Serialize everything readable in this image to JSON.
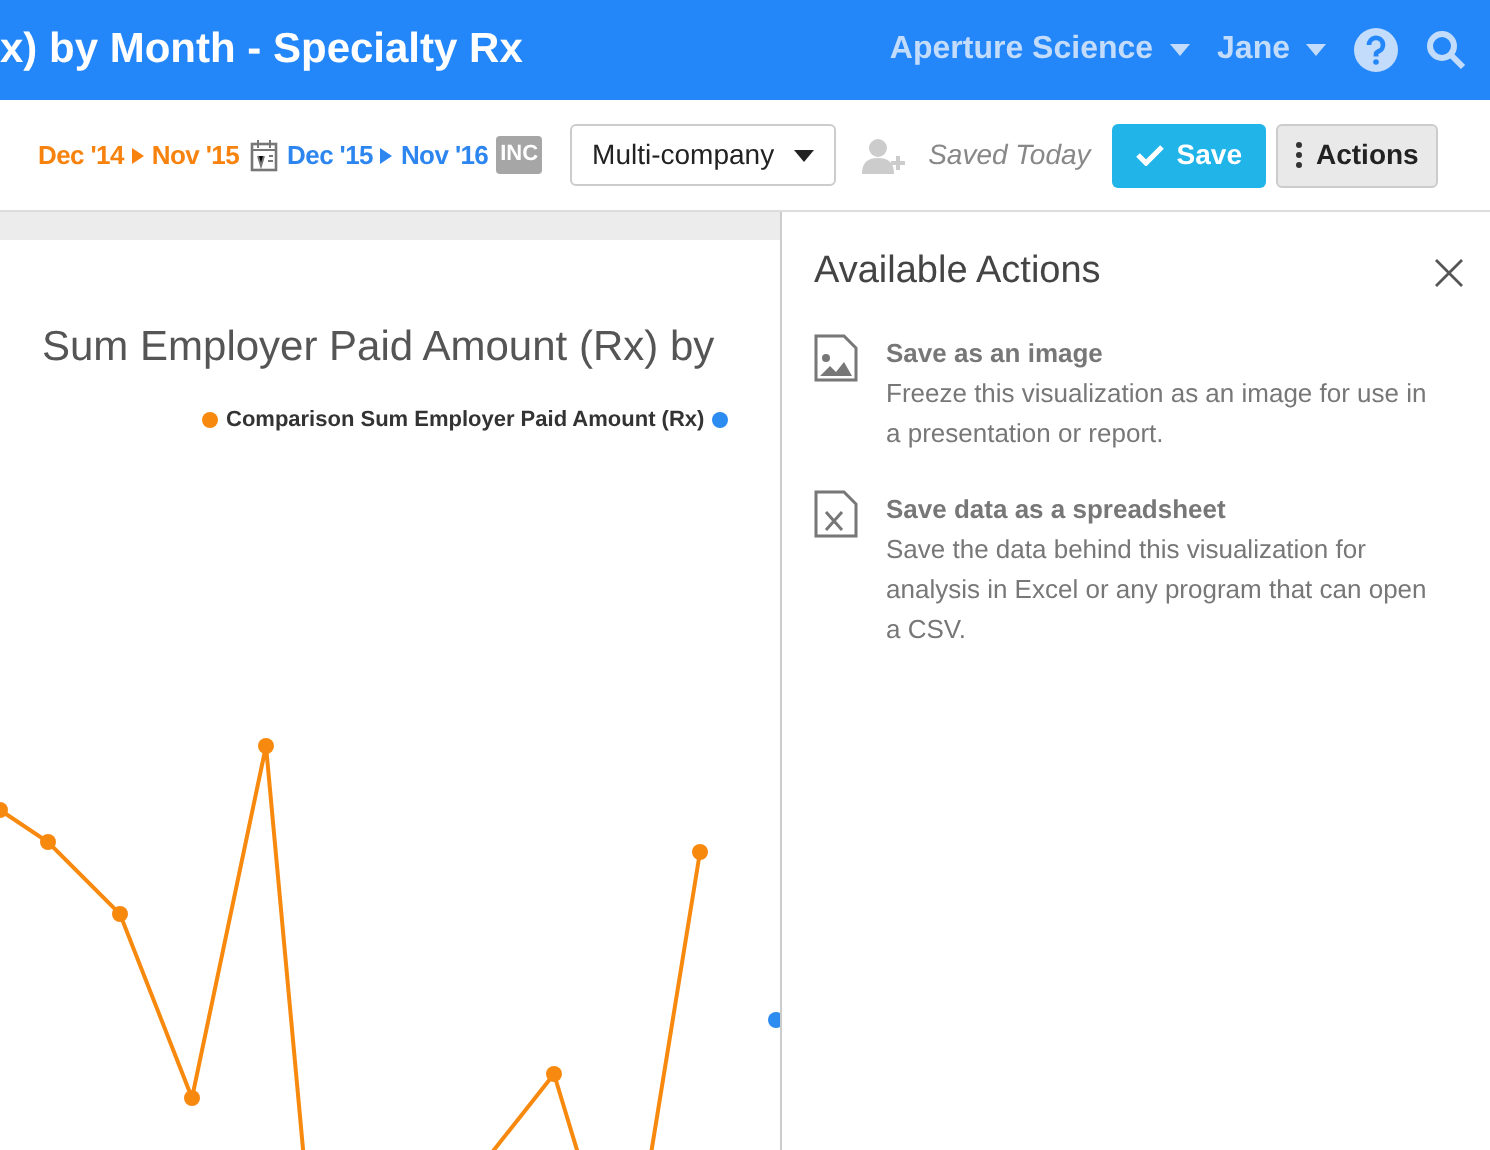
{
  "header": {
    "title": "x) by Month - Specialty Rx",
    "org": "Aperture Science",
    "user": "Jane"
  },
  "toolbar": {
    "range_a": {
      "start": "Dec '14",
      "end": "Nov '15"
    },
    "range_b": {
      "start": "Dec '15",
      "end": "Nov '16"
    },
    "badge": "INC",
    "dropdown": "Multi-company",
    "saved": "Saved Today",
    "save": "Save",
    "actions": "Actions"
  },
  "chart": {
    "title": "Sum Employer Paid Amount (Rx) by",
    "legend": [
      {
        "label": "Comparison Sum Employer Paid Amount (Rx)",
        "color": "#f7890f"
      },
      {
        "color": "#2d8cf0"
      }
    ]
  },
  "panel": {
    "title": "Available Actions",
    "actions": [
      {
        "kind": "image",
        "title": "Save as an image",
        "description": "Freeze this visualization as an image for use in a presentation or report."
      },
      {
        "kind": "spreadsheet",
        "title": "Save data as a spreadsheet",
        "description": "Save the data behind this visualization for analysis in Excel or any program that can open a CSV."
      }
    ]
  }
}
